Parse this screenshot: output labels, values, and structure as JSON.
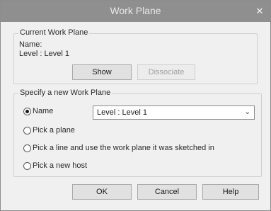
{
  "window": {
    "title": "Work Plane",
    "close_glyph": "✕"
  },
  "current": {
    "legend": "Current Work Plane",
    "name_label": "Name:",
    "name_value": "Level : Level 1",
    "show_label": "Show",
    "dissociate_label": "Dissociate"
  },
  "specify": {
    "legend": "Specify a new Work Plane",
    "options": [
      {
        "label": "Name",
        "checked": true
      },
      {
        "label": "Pick a plane",
        "checked": false
      },
      {
        "label": "Pick a line and use the work plane it was sketched in",
        "checked": false
      },
      {
        "label": "Pick a new host",
        "checked": false
      }
    ],
    "name_select_value": "Level : Level 1"
  },
  "footer": {
    "ok_label": "OK",
    "cancel_label": "Cancel",
    "help_label": "Help"
  }
}
